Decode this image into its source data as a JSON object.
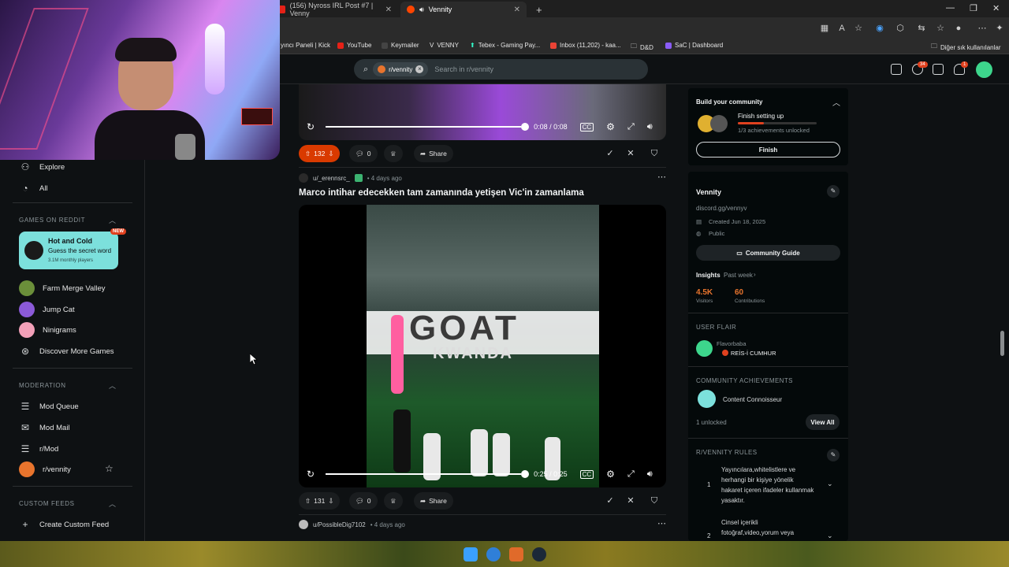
{
  "browser": {
    "tabs": [
      {
        "label": "(156) Nyross IRL Post #7 | Venny"
      },
      {
        "label": "Vennity"
      }
    ],
    "bookmarks": [
      "yıncı Paneli | Kick",
      "YouTube",
      "Keymailer",
      "VENNY",
      "Tebex - Gaming Pay...",
      "Inbox (11,202) - kaa...",
      "D&D",
      "SaC | Dashboard"
    ],
    "other_bookmarks": "Diğer sık kullanılanlar"
  },
  "reddit_header": {
    "search_chip": "r/vennity",
    "search_placeholder": "Search in r/vennity",
    "chat_badge": "34",
    "notif_badge": "1"
  },
  "sidebar": {
    "explore": "Explore",
    "all": "All",
    "games_header": "GAMES ON REDDIT",
    "featured_game": {
      "title": "Hot and Cold",
      "subtitle": "Guess the secret word",
      "meta": "3.1M monthly players",
      "badge": "NEW"
    },
    "games": [
      "Farm Merge Valley",
      "Jump Cat",
      "Ninigrams"
    ],
    "discover": "Discover More Games",
    "moderation_header": "MODERATION",
    "moderation": [
      "Mod Queue",
      "Mod Mail",
      "r/Mod",
      "r/vennity"
    ],
    "custom_feeds_header": "CUSTOM FEEDS",
    "create_feed": "Create Custom Feed"
  },
  "posts": [
    {
      "video_time": "0:08 / 0:08",
      "video_progress": 1.0,
      "votes": "132",
      "comments": "0",
      "share": "Share"
    },
    {
      "author": "u/_erennsrc_",
      "time": "• 4 days ago",
      "title": "Marco intihar edecekken tam zamanında yetişen Vic'in zamanlama",
      "video_overlay": "GOAT",
      "video_subtext": "KWANDA",
      "video_time": "0:25 / 0:25",
      "video_progress": 1.0,
      "votes": "131",
      "comments": "0",
      "share": "Share"
    },
    {
      "author": "u/PossibleDig7102",
      "time": "• 4 days ago"
    }
  ],
  "right": {
    "build_title": "Build your community",
    "setup_title": "Finish setting up",
    "setup_sub": "1/3 achievements unlocked",
    "setup_progress": 0.33,
    "finish_button": "Finish",
    "community_name": "Vennity",
    "community_link": "discord.gg/vennyv",
    "created": "Created Jun 18, 2025",
    "visibility": "Public",
    "guide_button": "Community Guide",
    "insights": "Insights",
    "insights_period": "Past week",
    "visitors_value": "4.5K",
    "visitors_label": "Visitors",
    "contrib_value": "60",
    "contrib_label": "Contributions",
    "flair_header": "USER FLAIR",
    "flair_user": "Flavorbaba",
    "flair_tag": "REİS-İ CUMHUR",
    "achievements_header": "COMMUNITY ACHIEVEMENTS",
    "achievement": "Content Connoisseur",
    "unlocked": "1 unlocked",
    "view_all": "View All",
    "rules_header": "R/VENNITY RULES",
    "rules": [
      {
        "num": "1",
        "text": "Yayıncılara,whitelistlere ve herhangi bir kişiye yönelik hakaret içeren ifadeler kullanmak yasaktır."
      },
      {
        "num": "2",
        "text": "Cinsel içerikli fotoğraf,video,yorum veya"
      }
    ]
  },
  "colors": {
    "upvote_active": "#d93a00",
    "teal": "#7ce0dc",
    "panel": "#04090a"
  }
}
